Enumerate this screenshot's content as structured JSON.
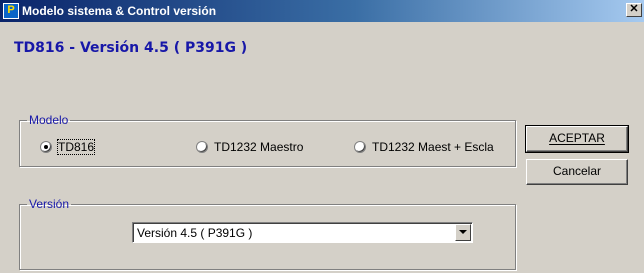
{
  "window": {
    "title": "Modelo sistema & Control versión",
    "close_glyph": "✕"
  },
  "heading": "TD816 - Versión 4.5 ( P391G )",
  "modelo": {
    "legend": "Modelo",
    "options": [
      {
        "label": "TD816",
        "checked": true
      },
      {
        "label": "TD1232 Maestro",
        "checked": false
      },
      {
        "label": "TD1232 Maest + Escla",
        "checked": false
      }
    ]
  },
  "buttons": {
    "accept": "ACEPTAR",
    "cancel": "Cancelar"
  },
  "version": {
    "legend": "Versión",
    "selected": "Versión 4.5 ( P391G )"
  },
  "colors": {
    "accent": "#1717a8",
    "titlebar_start": "#0a246a",
    "titlebar_end": "#a6caf0",
    "face": "#d4d0c8"
  },
  "icons": {
    "app": "app-icon",
    "close": "close-icon",
    "dropdown": "chevron-down-icon"
  }
}
